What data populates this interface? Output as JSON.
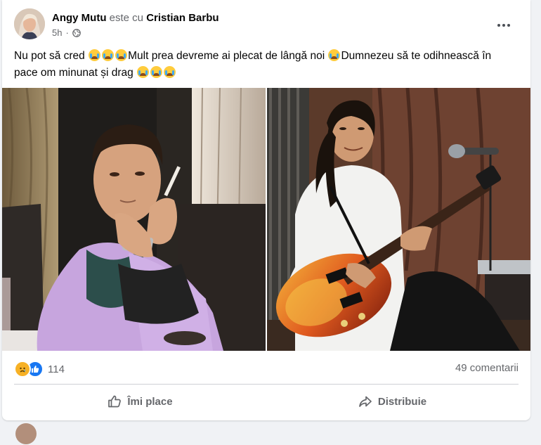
{
  "post": {
    "author": "Angy Mutu",
    "with_word": "este cu",
    "tagged": "Cristian Barbu",
    "time": "5h",
    "privacy_icon": "globe-icon",
    "more_icon": "more-dots-icon",
    "text_parts": [
      "Nu pot să cred",
      "Mult prea devreme ai plecat de lângă noi",
      "Dumnezeu să te odihnească în pace om minunat și drag"
    ],
    "emoji": "crying-face-emoji"
  },
  "reactions": {
    "count": "114",
    "icons": [
      "sad-reaction-icon",
      "like-reaction-icon"
    ],
    "comments": "49 comentarii"
  },
  "actions": {
    "like_label": "Îmi place",
    "share_label": "Distribuie"
  },
  "colors": {
    "like_blue": "#1877f2",
    "sad_yellow": "#f7b125",
    "secondary_text": "#65676b"
  }
}
